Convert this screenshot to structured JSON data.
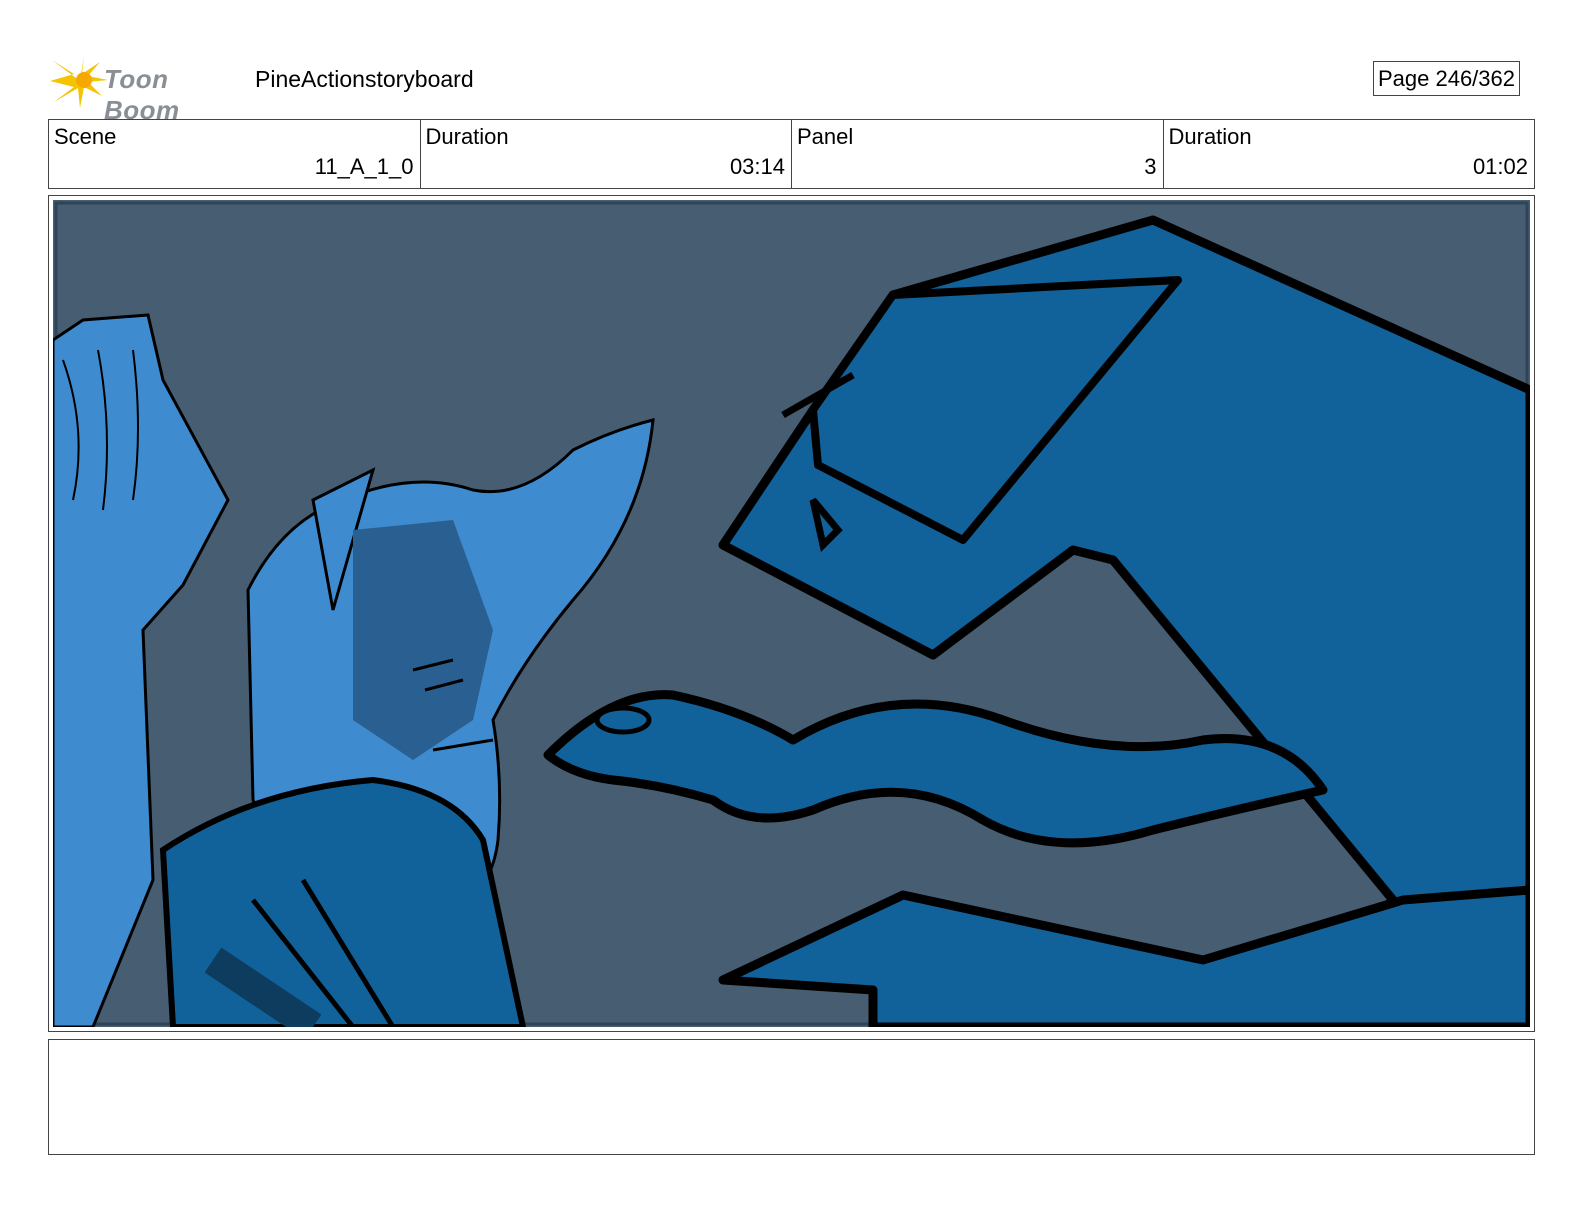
{
  "header": {
    "brand": "Toon Boom",
    "project": "PineActionstoryboard",
    "page": "Page 246/362"
  },
  "info": {
    "scene_label": "Scene",
    "scene_value": "11_A_1_0",
    "duration_label": "Duration",
    "duration_value": "03:14",
    "panel_label": "Panel",
    "panel_value": "3",
    "panel_duration_label": "Duration",
    "panel_duration_value": "01:02"
  },
  "colors": {
    "background": "#465d72",
    "hero_light": "#3e8bd0",
    "hero_dark": "#2a5f91",
    "creature": "#11629b",
    "ink": "#000000",
    "logo_star": "#f5c400"
  },
  "notes": ""
}
